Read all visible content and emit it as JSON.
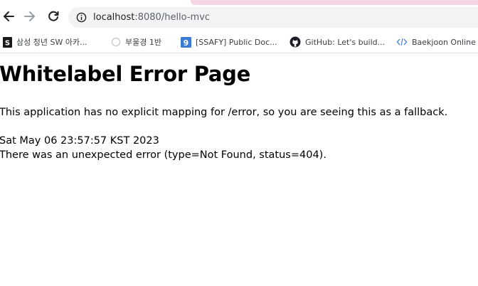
{
  "browser": {
    "url_host": "localhost",
    "url_path": ":8080/hello-mvc",
    "bookmarks": [
      {
        "label": "삼성 청년 SW 아카...",
        "icon": "samsung-favicon-icon"
      },
      {
        "label": "부울경 1반",
        "icon": "loading-circle-icon"
      },
      {
        "label": "[SSAFY] Public Doc...",
        "icon": "nine-square-favicon-icon"
      },
      {
        "label": "GitHub: Let's build...",
        "icon": "github-icon"
      },
      {
        "label": "Baekjoon Online",
        "icon": "code-brackets-icon"
      }
    ]
  },
  "page": {
    "title": "Whitelabel Error Page",
    "message": "This application has no explicit mapping for /error, so you are seeing this as a fallback.",
    "timestamp": "Sat May 06 23:57:57 KST 2023",
    "error_detail": "There was an unexpected error (type=Not Found, status=404)."
  }
}
